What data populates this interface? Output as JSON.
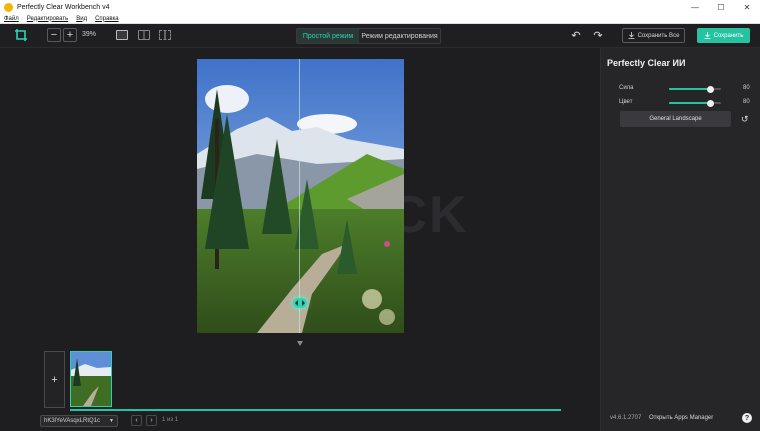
{
  "window": {
    "title": "Perfectly Clear Workbench v4",
    "controls": [
      "—",
      "☐",
      "✕"
    ]
  },
  "menu": [
    {
      "label": "Файл"
    },
    {
      "label": "Редактировать"
    },
    {
      "label": "Вид"
    },
    {
      "label": "Справка"
    }
  ],
  "toolbar": {
    "zoom_out": "−",
    "zoom_in": "+",
    "zoom_level": "39%",
    "mode_simple": "Простой режим",
    "mode_edit": "Режим редактирования",
    "undo": "↶",
    "redo": "↷",
    "save_all": "Сохранить Все",
    "save": "Сохранить"
  },
  "canvas": {
    "watermark": "ACK",
    "collapse": "▾"
  },
  "filmstrip": {
    "add": "+",
    "file_name": "hK3lYeVAsqxLRtQ1c",
    "prev": "‹",
    "next": "›",
    "page": "1 из 1",
    "progress_fraction": 1.0
  },
  "panel": {
    "title": "Perfectly Clear ИИ",
    "sliders": [
      {
        "label": "Сила",
        "value": "80",
        "fraction": 0.8
      },
      {
        "label": "Цвет",
        "value": "80",
        "fraction": 0.8
      }
    ],
    "preset": "General Landscape",
    "reset": "↺",
    "version": "v4.6.1.2707",
    "apps_manager": "Открыть Apps Manager",
    "help": "?"
  },
  "colors": {
    "accent": "#25c3a2",
    "background": "#1e1e21",
    "panel": "#262629"
  }
}
